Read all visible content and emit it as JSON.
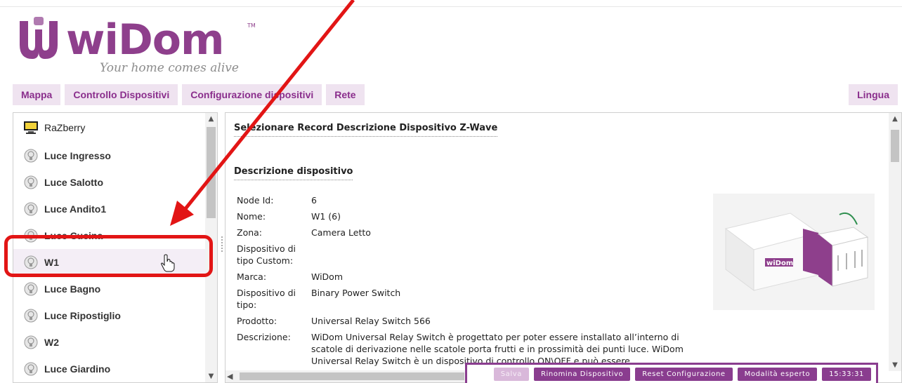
{
  "logo": {
    "word": "wiDom",
    "tm": "TM",
    "tagline": "Your home comes alive"
  },
  "nav": {
    "tabs": [
      "Mappa",
      "Controllo Dispositivi",
      "Configurazione dispositivi",
      "Rete"
    ],
    "language": "Lingua"
  },
  "devices": [
    {
      "label": "RaZberry",
      "icon": "computer-icon"
    },
    {
      "label": "Luce Ingresso",
      "icon": "bulb-icon"
    },
    {
      "label": "Luce Salotto",
      "icon": "bulb-icon"
    },
    {
      "label": "Luce Andito1",
      "icon": "bulb-icon"
    },
    {
      "label": "Luce Cucina",
      "icon": "bulb-icon"
    },
    {
      "label": "W1",
      "icon": "bulb-icon",
      "selected": true
    },
    {
      "label": "Luce Bagno",
      "icon": "bulb-icon"
    },
    {
      "label": "Luce Ripostiglio",
      "icon": "bulb-icon"
    },
    {
      "label": "W2",
      "icon": "bulb-icon"
    },
    {
      "label": "Luce Giardino",
      "icon": "bulb-icon"
    }
  ],
  "detail": {
    "title": "Selezionare Record Descrizione Dispositivo Z-Wave",
    "section_title": "Descrizione dispositivo",
    "fields": [
      {
        "label": "Node Id:",
        "value": "6"
      },
      {
        "label": "Nome:",
        "value": "W1 (6)"
      },
      {
        "label": "Zona:",
        "value": "Camera Letto"
      },
      {
        "label": "Dispositivo di tipo Custom:",
        "value": ""
      },
      {
        "label": "Marca:",
        "value": "WiDom"
      },
      {
        "label": "Dispositivo di tipo:",
        "value": "Binary Power Switch"
      },
      {
        "label": "Prodotto:",
        "value": "Universal Relay Switch 566"
      },
      {
        "label": "Descrizione:",
        "value": "WiDom Universal Relay Switch è progettato per poter essere installato all’interno di scatole di derivazione nelle scatole porta frutti e in prossimità dei punti luce. WiDom Universal Relay Switch è un dispositivo di controllo ON\\OFF e può essere"
      }
    ],
    "product_image_brand": "wiDom"
  },
  "actions": {
    "save": "Salva",
    "rename": "Rinomina Dispositivo",
    "reset": "Reset Configurazione",
    "expert": "Modalità esperto",
    "clock": "15:33:31"
  },
  "colors": {
    "brand": "#8e3f8c",
    "nav_bg": "#efe3f0",
    "action_bg": "#8a3d8f",
    "highlight": "#e21515"
  }
}
